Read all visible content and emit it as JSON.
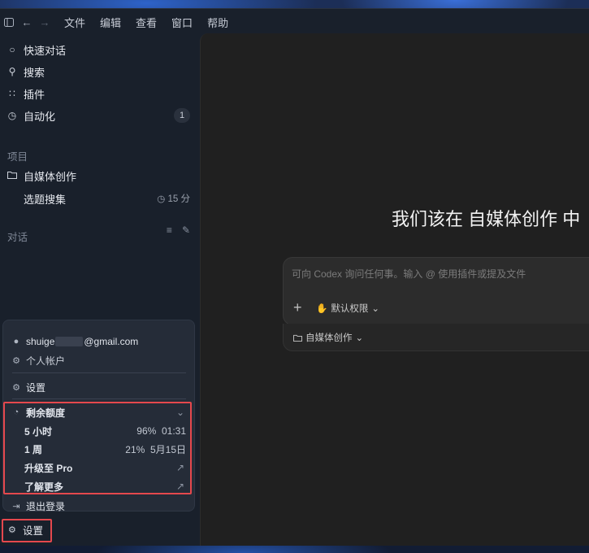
{
  "menubar": {
    "items": [
      "文件",
      "编辑",
      "查看",
      "窗口",
      "帮助"
    ]
  },
  "sidebar": {
    "nav": [
      {
        "icon": "chat-bubble-icon",
        "label": "快速对话"
      },
      {
        "icon": "search-icon",
        "label": "搜索"
      },
      {
        "icon": "plugin-grid-icon",
        "label": "插件"
      },
      {
        "icon": "clock-icon",
        "label": "自动化",
        "badge": "1"
      }
    ],
    "projects_heading": "项目",
    "project": {
      "label": "自媒体创作",
      "sub_item": "选题搜集",
      "sub_time": "15 分"
    },
    "conversations_heading": "对话"
  },
  "account_menu": {
    "email_prefix": "shuige",
    "email_suffix": "@gmail.com",
    "personal_account": "个人帐户",
    "settings": "设置",
    "quota": {
      "title": "剩余额度",
      "rows": [
        {
          "label": "5 小时",
          "percent": "96%",
          "reset": "01:31"
        },
        {
          "label": "1 周",
          "percent": "21%",
          "reset": "5月15日"
        }
      ],
      "upgrade": "升级至 Pro",
      "learn_more": "了解更多"
    },
    "logout": "退出登录"
  },
  "bottom_settings": "设置",
  "main": {
    "headline": "我们该在 自媒体创作 中",
    "composer_placeholder": "可向 Codex 询问任何事。输入 @ 使用插件或提及文件",
    "permission": "默认权限",
    "project_selector": "自媒体创作"
  },
  "colors": {
    "highlight": "#e5484d",
    "sidebar_bg": "#19202b",
    "main_bg": "#202020"
  }
}
